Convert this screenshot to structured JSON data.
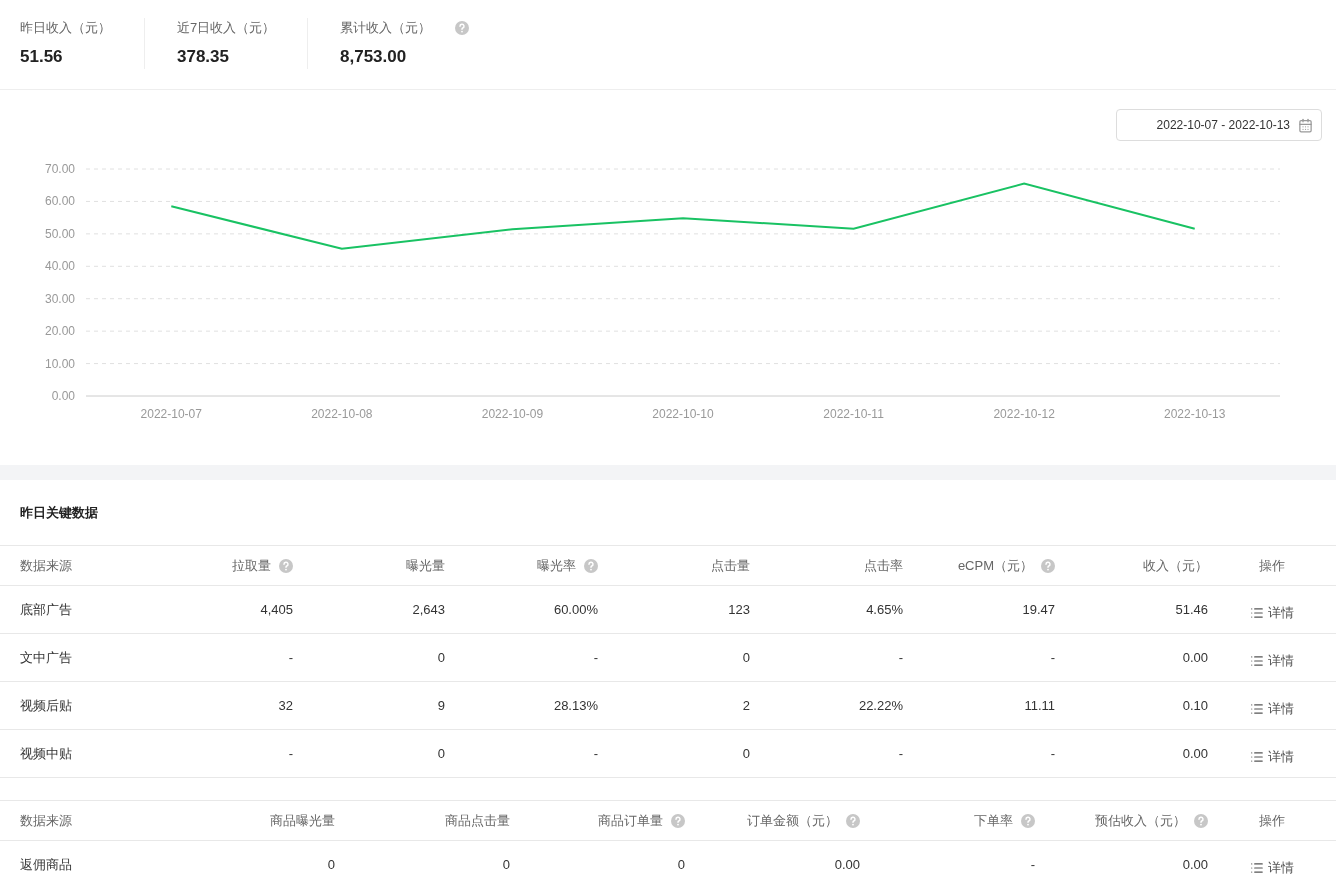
{
  "summary": [
    {
      "label": "昨日收入（元）",
      "value": "51.56",
      "help": false
    },
    {
      "label": "近7日收入（元）",
      "value": "378.35",
      "help": false
    },
    {
      "label": "累计收入（元）",
      "value": "8,753.00",
      "help": true
    }
  ],
  "date_range": {
    "value": "2022-10-07 - 2022-10-13"
  },
  "chart": {
    "chart_data": {
      "type": "line",
      "categories": [
        "2022-10-07",
        "2022-10-08",
        "2022-10-09",
        "2022-10-10",
        "2022-10-11",
        "2022-10-12",
        "2022-10-13"
      ],
      "series": [
        {
          "color": "#19c263",
          "values": [
            58.5,
            45.4,
            51.4,
            54.8,
            51.6,
            65.5,
            51.6
          ]
        }
      ],
      "grid": true,
      "ylim": [
        0,
        70
      ],
      "yticks": [
        {
          "value": 0,
          "label": "0.00"
        },
        {
          "value": 10,
          "label": "10.00"
        },
        {
          "value": 20,
          "label": "20.00"
        },
        {
          "value": 30,
          "label": "30.00"
        },
        {
          "value": 40,
          "label": "40.00"
        },
        {
          "value": 50,
          "label": "50.00"
        },
        {
          "value": 60,
          "label": "60.00"
        },
        {
          "value": 70,
          "label": "70.00"
        }
      ]
    }
  },
  "section_title": "昨日关键数据",
  "tables": [
    {
      "columns": [
        {
          "label": "数据来源",
          "help": false
        },
        {
          "label": "拉取量",
          "help": true
        },
        {
          "label": "曝光量",
          "help": false
        },
        {
          "label": "曝光率",
          "help": true
        },
        {
          "label": "点击量",
          "help": false
        },
        {
          "label": "点击率",
          "help": false
        },
        {
          "label": "eCPM（元）",
          "help": true
        },
        {
          "label": "收入（元）",
          "help": false
        },
        {
          "label": "操作",
          "help": false
        }
      ],
      "rows": [
        {
          "cells": [
            "底部广告",
            "4,405",
            "2,643",
            "60.00%",
            "123",
            "4.65%",
            "19.47",
            "51.46"
          ],
          "action": "详情"
        },
        {
          "cells": [
            "文中广告",
            "-",
            "0",
            "-",
            "0",
            "-",
            "-",
            "0.00"
          ],
          "action": "详情"
        },
        {
          "cells": [
            "视频后贴",
            "32",
            "9",
            "28.13%",
            "2",
            "22.22%",
            "11.11",
            "0.10"
          ],
          "action": "详情"
        },
        {
          "cells": [
            "视频中贴",
            "-",
            "0",
            "-",
            "0",
            "-",
            "-",
            "0.00"
          ],
          "action": "详情"
        }
      ]
    },
    {
      "columns": [
        {
          "label": "数据来源",
          "help": false
        },
        {
          "label": "商品曝光量",
          "help": false
        },
        {
          "label": "商品点击量",
          "help": false
        },
        {
          "label": "商品订单量",
          "help": true
        },
        {
          "label": "订单金额（元）",
          "help": true
        },
        {
          "label": "下单率",
          "help": true
        },
        {
          "label": "预估收入（元）",
          "help": true
        },
        {
          "label": "操作",
          "help": false
        }
      ],
      "rows": [
        {
          "cells": [
            "返佣商品",
            "0",
            "0",
            "0",
            "0.00",
            "-",
            "0.00"
          ],
          "action": "详情"
        }
      ]
    }
  ]
}
